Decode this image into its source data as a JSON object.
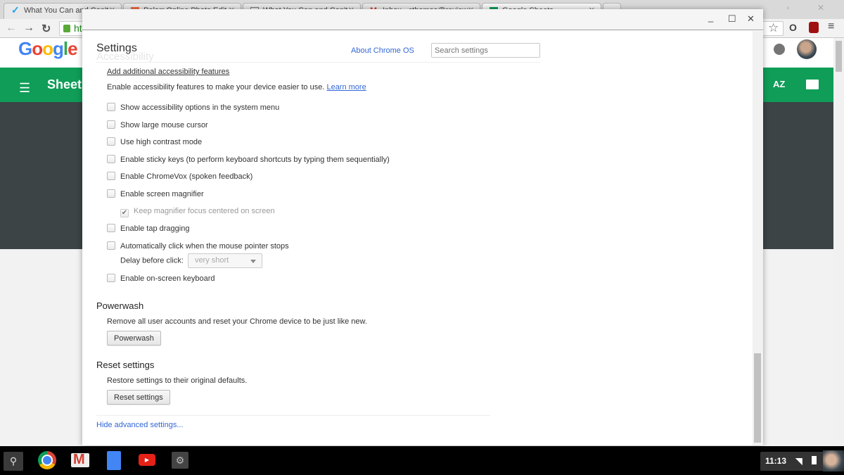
{
  "browser": {
    "tabs": [
      {
        "label": "What You Can and Can't",
        "icon": "check-favicon",
        "active": false
      },
      {
        "label": "Polarr Online Photo Edit",
        "icon": "polarr-favicon",
        "active": false
      },
      {
        "label": "What You Can and Can't",
        "icon": "doc-favicon",
        "active": false
      },
      {
        "label": "Inbox - cthomas@review",
        "icon": "gmail-favicon",
        "active": false
      },
      {
        "label": "Google Sheets",
        "icon": "sheets-favicon",
        "active": true
      }
    ],
    "url_fragment": "ht",
    "window_controls": [
      "minimize",
      "restore",
      "close"
    ]
  },
  "page": {
    "logo": "Google",
    "app_title": "Sheets",
    "sort_label": "AZ",
    "colors": {
      "green": "#0f9d58",
      "dark": "#3c4446"
    }
  },
  "dialog": {
    "window_controls": {
      "minimize": "_",
      "maximize": "☐",
      "close": "✕"
    },
    "title": "Settings",
    "ghost_title": "Accessibility",
    "about_link": "About Chrome OS",
    "search_placeholder": "Search settings",
    "add_features_link": "Add additional accessibility features",
    "intro_text": "Enable accessibility features to make your device easier to use.",
    "learn_more": "Learn more",
    "options": [
      {
        "label": "Show accessibility options in the system menu",
        "checked": false
      },
      {
        "label": "Show large mouse cursor",
        "checked": false
      },
      {
        "label": "Use high contrast mode",
        "checked": false
      },
      {
        "label": "Enable sticky keys (to perform keyboard shortcuts by typing them sequentially)",
        "checked": false
      },
      {
        "label": "Enable ChromeVox (spoken feedback)",
        "checked": false
      },
      {
        "label": "Enable screen magnifier",
        "checked": false
      },
      {
        "label": "Keep magnifier focus centered on screen",
        "checked": true,
        "disabled": true
      },
      {
        "label": "Enable tap dragging",
        "checked": false
      },
      {
        "label": "Automatically click when the mouse pointer stops",
        "checked": false
      },
      {
        "label": "Enable on-screen keyboard",
        "checked": false
      }
    ],
    "delay_label": "Delay before click:",
    "delay_value": "very short",
    "powerwash": {
      "heading": "Powerwash",
      "description": "Remove all user accounts and reset your Chrome device to be just like new.",
      "button": "Powerwash"
    },
    "reset": {
      "heading": "Reset settings",
      "description": "Restore settings to their original defaults.",
      "button": "Reset settings"
    },
    "hide_advanced": "Hide advanced settings..."
  },
  "shelf": {
    "apps": [
      "launcher",
      "chrome",
      "gmail",
      "docs",
      "youtube",
      "settings"
    ],
    "time": "11:13"
  }
}
